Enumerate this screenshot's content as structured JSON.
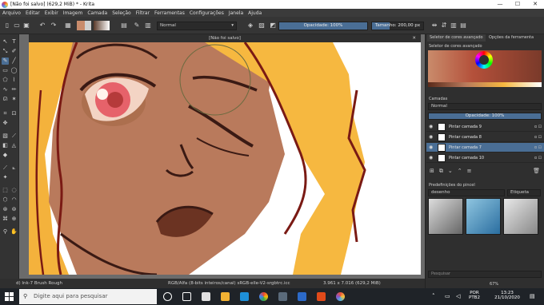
{
  "window": {
    "title": "[Não foi salvo]  (629,2 MiB)  * - Krita",
    "controls": [
      "—",
      "☐",
      "✕"
    ]
  },
  "menu": [
    "Arquivo",
    "Editar",
    "Exibir",
    "Imagem",
    "Camada",
    "Seleção",
    "Filtrar",
    "Ferramentas",
    "Configurações",
    "Janela",
    "Ajuda"
  ],
  "toolbar": {
    "blend_mode": "Normal",
    "opacity_label": "Opacidade: 100%",
    "opacity_value": 1.0,
    "size_label": "Tamanho: 200,00 px",
    "size_fraction": 0.35
  },
  "canvas": {
    "doc_tab": "[Não foi salvo]"
  },
  "status": {
    "brush": "d) Ink-7 Brush Rough",
    "color_info": "RGB/Alfa (8-bits inteiros/canal)  sRGB-elle-V2-srgbtrc.icc",
    "dimensions": "3.961 x 7.016 (629,2 MiB)",
    "zoom": "67%"
  },
  "docker": {
    "tabs": [
      "Seletor de cores avançado",
      "Opções da ferramenta"
    ],
    "color_selector_title": "Seletor de cores avançado",
    "layers_title": "Camadas",
    "layers_blend": "Normal",
    "layers_opacity": "Opacidade: 100%",
    "layers": [
      {
        "name": "Pintar camada 9",
        "selected": false
      },
      {
        "name": "Pintar camada 8",
        "selected": false
      },
      {
        "name": "Pintar camada 7",
        "selected": true
      },
      {
        "name": "Pintar camada 10",
        "selected": false
      }
    ],
    "presets_title": "Predefinições do pincel",
    "presets_filter": "desenho",
    "presets_tag": "Etiqueta",
    "search_placeholder": "Pesquisar"
  },
  "taskbar": {
    "search_placeholder": "Digite aqui para pesquisar",
    "lang": "POR",
    "lang2": "PTB2",
    "time": "13:23",
    "date": "21/10/2020"
  },
  "colors": {
    "accent": "#4a6e95",
    "fg_color": "#c98b6b",
    "skin": "#b97a5c",
    "hair": "#f6b840",
    "outline": "#3a1a14"
  }
}
